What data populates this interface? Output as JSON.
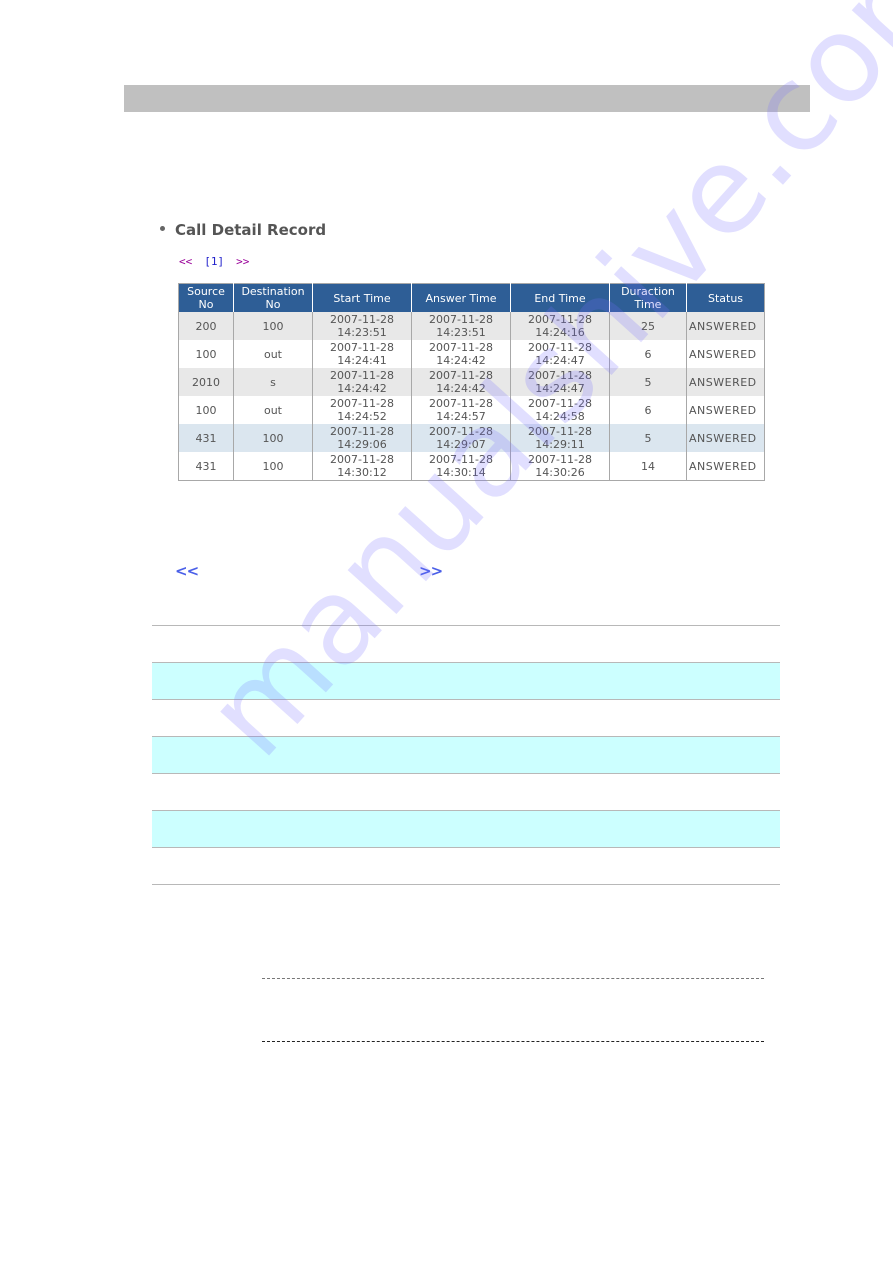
{
  "section": {
    "title": "Call Detail Record"
  },
  "pager": {
    "prev": "<<",
    "page": "[1]",
    "next": ">>"
  },
  "table": {
    "headers": [
      [
        "Source",
        "No"
      ],
      [
        "Destination",
        "No"
      ],
      [
        "Start Time"
      ],
      [
        "Answer Time"
      ],
      [
        "End Time"
      ],
      [
        "Duraction",
        "Time"
      ],
      [
        "Status"
      ]
    ],
    "rows": [
      {
        "source": "200",
        "destination": "100",
        "start": [
          "2007-11-28",
          "14:23:51"
        ],
        "answer": [
          "2007-11-28",
          "14:23:51"
        ],
        "end": [
          "2007-11-28",
          "14:24:16"
        ],
        "duration": "25",
        "status": "ANSWERED"
      },
      {
        "source": "100",
        "destination": "out",
        "start": [
          "2007-11-28",
          "14:24:41"
        ],
        "answer": [
          "2007-11-28",
          "14:24:42"
        ],
        "end": [
          "2007-11-28",
          "14:24:47"
        ],
        "duration": "6",
        "status": "ANSWERED"
      },
      {
        "source": "2010",
        "destination": "s",
        "start": [
          "2007-11-28",
          "14:24:42"
        ],
        "answer": [
          "2007-11-28",
          "14:24:42"
        ],
        "end": [
          "2007-11-28",
          "14:24:47"
        ],
        "duration": "5",
        "status": "ANSWERED"
      },
      {
        "source": "100",
        "destination": "out",
        "start": [
          "2007-11-28",
          "14:24:52"
        ],
        "answer": [
          "2007-11-28",
          "14:24:57"
        ],
        "end": [
          "2007-11-28",
          "14:24:58"
        ],
        "duration": "6",
        "status": "ANSWERED"
      },
      {
        "source": "431",
        "destination": "100",
        "start": [
          "2007-11-28",
          "14:29:06"
        ],
        "answer": [
          "2007-11-28",
          "14:29:07"
        ],
        "end": [
          "2007-11-28",
          "14:29:11"
        ],
        "duration": "5",
        "status": "ANSWERED"
      },
      {
        "source": "431",
        "destination": "100",
        "start": [
          "2007-11-28",
          "14:30:12"
        ],
        "answer": [
          "2007-11-28",
          "14:30:14"
        ],
        "end": [
          "2007-11-28",
          "14:30:26"
        ],
        "duration": "14",
        "status": "ANSWERED"
      }
    ]
  },
  "big_pager": {
    "prev": "<<",
    "next": ">>"
  },
  "watermark": "manualshive.com",
  "colors": {
    "header_bar": "#c0c0c0",
    "table_header": "#2e5e96",
    "row_gray": "#e8e8e8",
    "row_highlight": "#dbe6ef",
    "stripe_cyan": "#ccffff",
    "pager_nav": "#990099",
    "pager_page": "#2222cc",
    "big_pager": "#4a5fe8"
  }
}
